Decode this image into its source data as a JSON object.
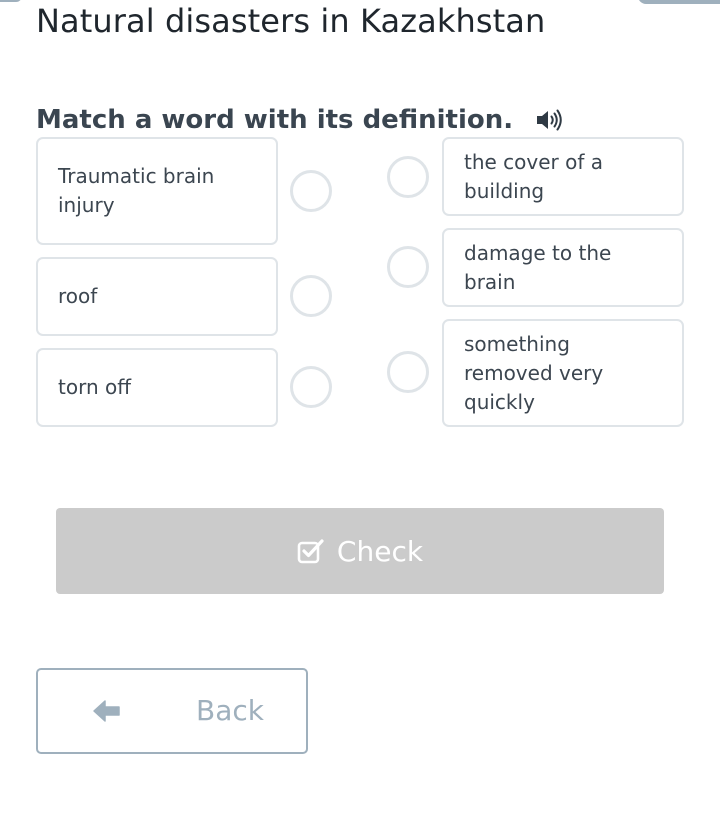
{
  "header": {
    "title": "Natural disasters in Kazakhstan"
  },
  "task": {
    "instruction": "Match a word with its definition."
  },
  "words": [
    {
      "label": "Traumatic brain injury"
    },
    {
      "label": "roof"
    },
    {
      "label": "torn off"
    }
  ],
  "definitions": [
    {
      "label": "the cover of a building"
    },
    {
      "label": "damage to the brain"
    },
    {
      "label": "something removed very quickly"
    }
  ],
  "actions": {
    "check_label": "Check",
    "back_label": "Back"
  },
  "icons": {
    "audio": "speaker-icon",
    "check": "checkbox-check-icon",
    "back": "arrow-left-icon"
  },
  "colors": {
    "card_border": "#dfe4e8",
    "check_button_disabled": "#cbcbcb",
    "back_accent": "#9fb0bd"
  }
}
